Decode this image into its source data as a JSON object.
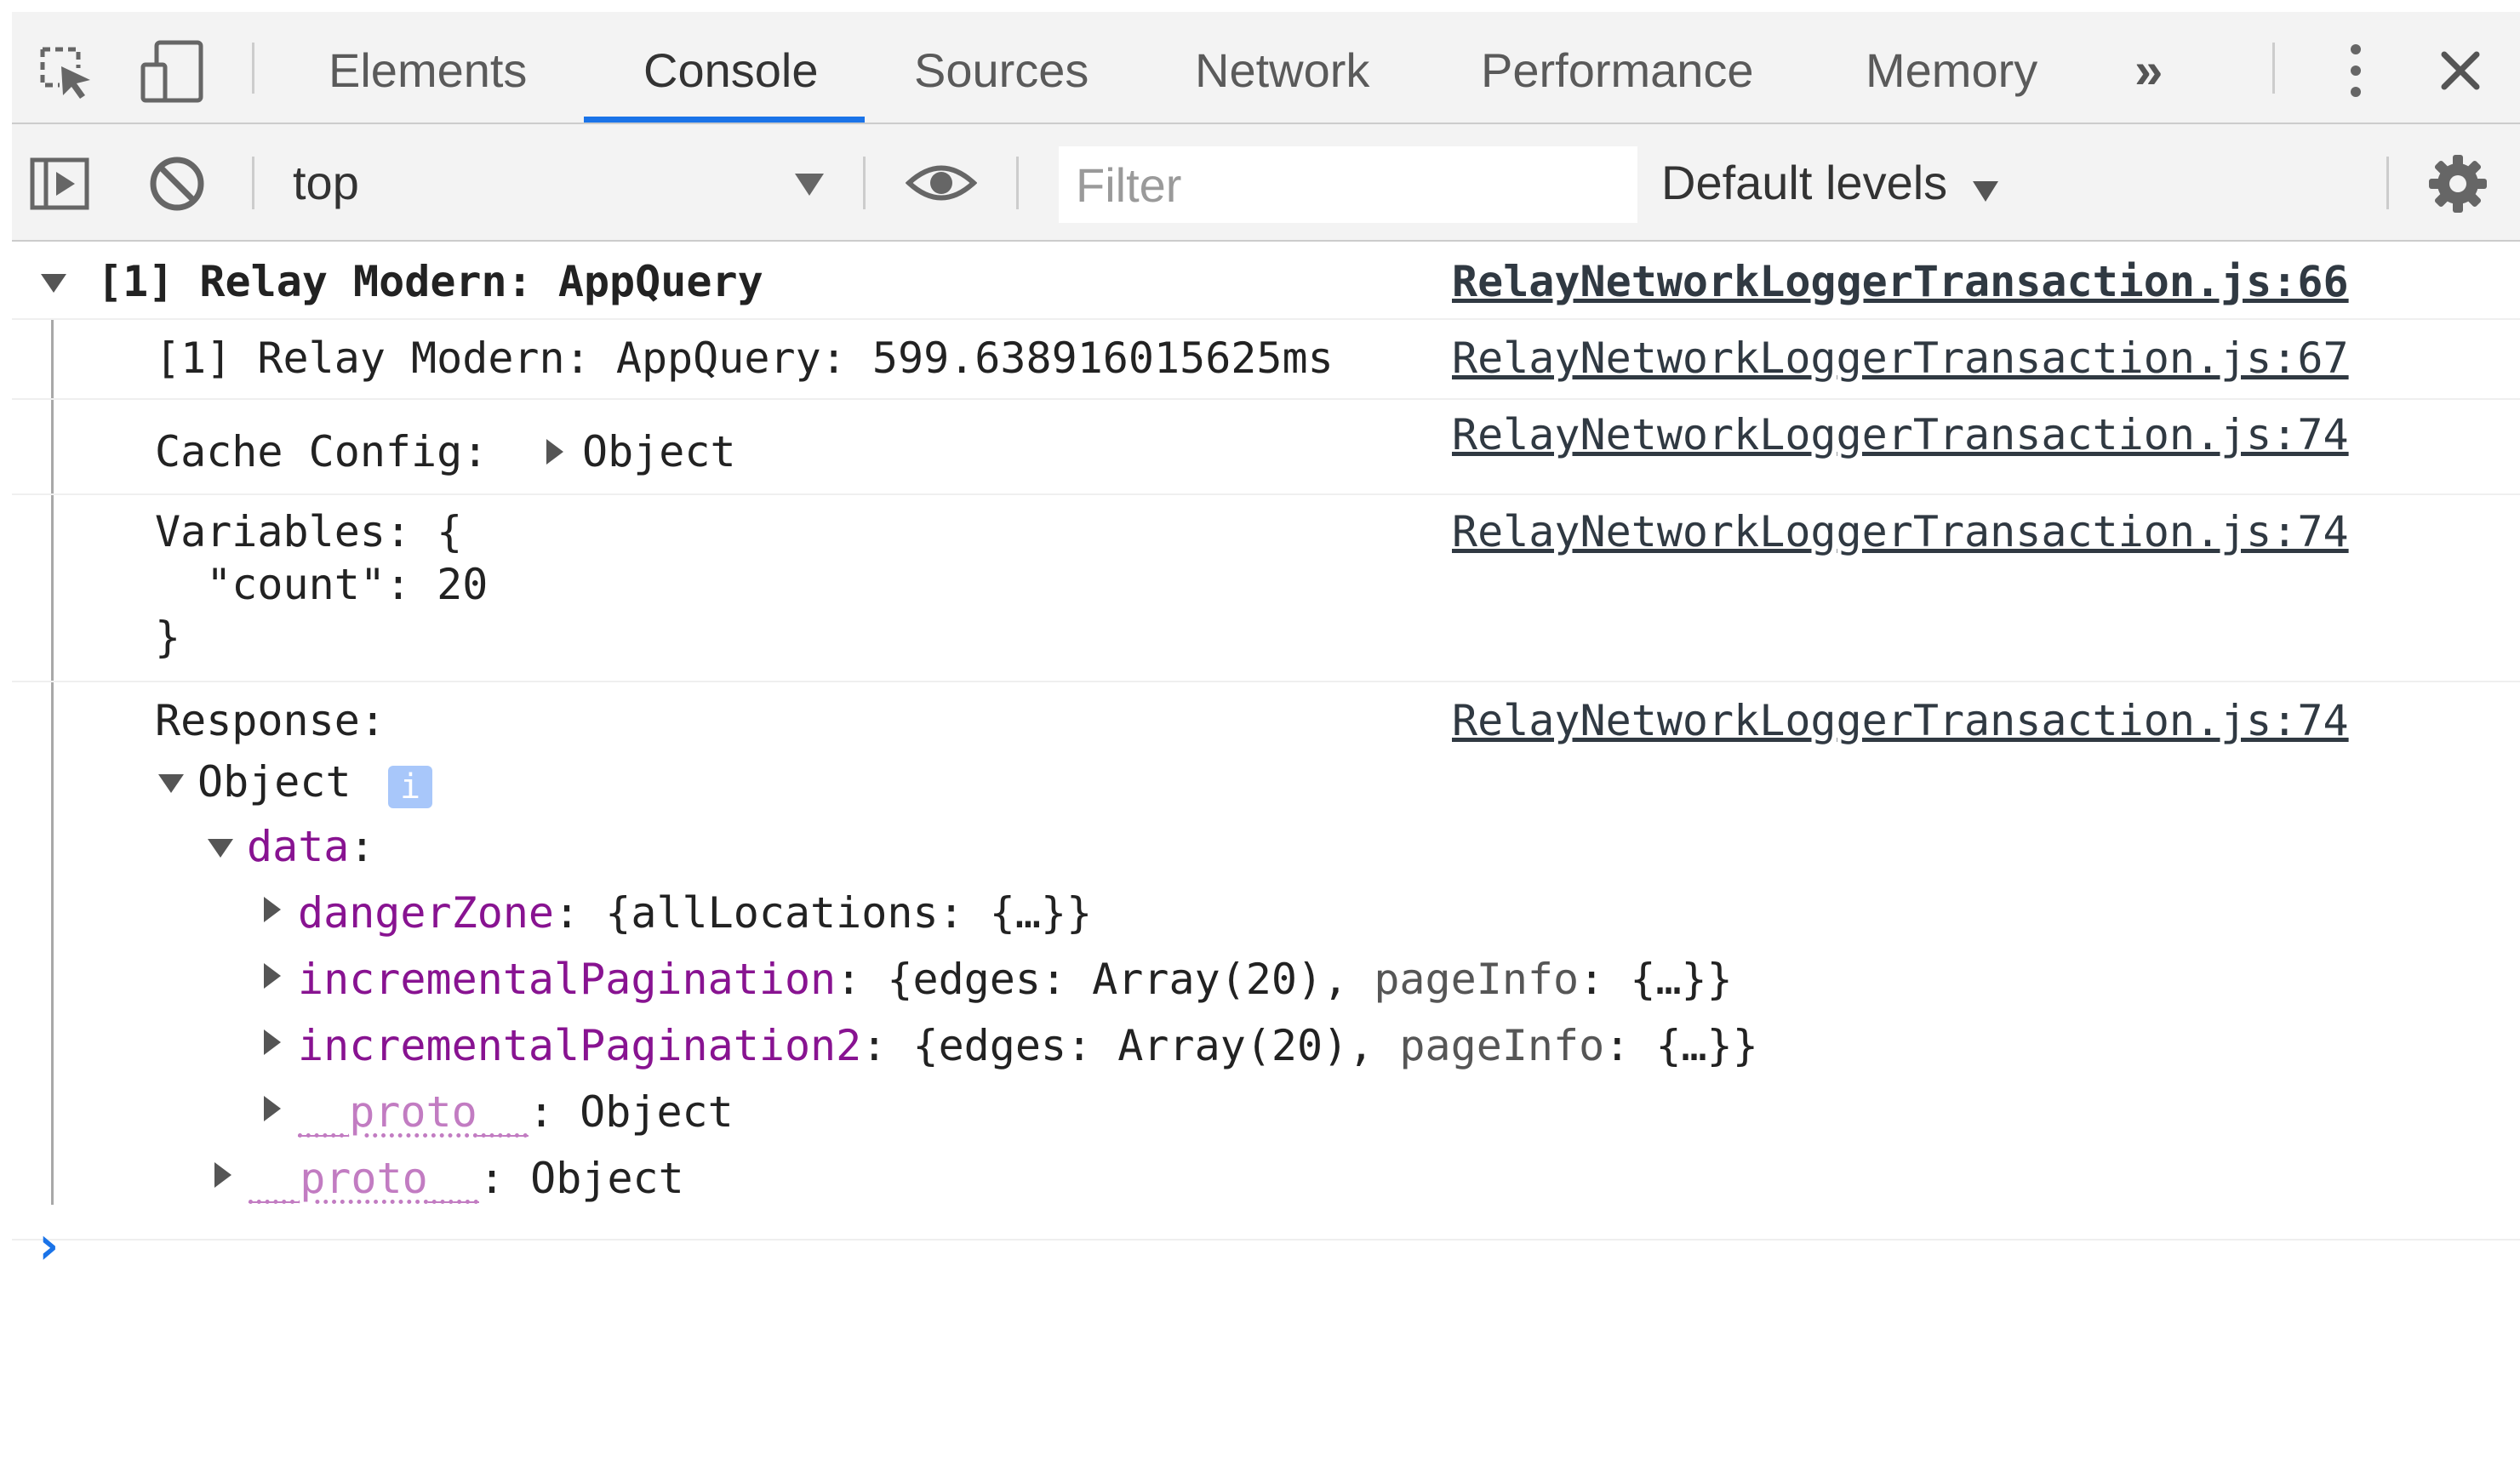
{
  "devtools": {
    "tabs": [
      {
        "label": "Elements"
      },
      {
        "label": "Console"
      },
      {
        "label": "Sources"
      },
      {
        "label": "Network"
      },
      {
        "label": "Performance"
      },
      {
        "label": "Memory"
      }
    ],
    "more_tabs_glyph": "»",
    "active_tab": "Console",
    "accent_color": "#1a73e8",
    "icons": [
      "inspect-element-icon",
      "device-toolbar-icon",
      "more-tabs-icon",
      "kebab-menu-icon",
      "close-icon"
    ]
  },
  "toolbar": {
    "context": "top",
    "filter_placeholder": "Filter",
    "levels": "Default levels",
    "icons": [
      "sidebar-toggle-icon",
      "clear-console-icon",
      "live-expression-eye-icon",
      "settings-gear-icon"
    ]
  },
  "console": {
    "group": {
      "title": "[1] Relay Modern: AppQuery",
      "source": "RelayNetworkLoggerTransaction.js:66"
    },
    "timing": {
      "text": "[1] Relay Modern: AppQuery: 599.638916015625ms",
      "source": "RelayNetworkLoggerTransaction.js:67"
    },
    "cache_config": {
      "label": "Cache Config:",
      "value": "Object",
      "source": "RelayNetworkLoggerTransaction.js:74"
    },
    "variables": {
      "line1": "Variables: {",
      "line2": "  \"count\": 20",
      "line3": "}",
      "source": "RelayNetworkLoggerTransaction.js:74"
    },
    "response": {
      "label": "Response:",
      "source": "RelayNetworkLoggerTransaction.js:74",
      "object_label": "Object",
      "info_badge": "i",
      "data_key": "data",
      "data_colon": ":",
      "entries": [
        {
          "key": "dangerZone",
          "preview": ": {allLocations: {…}}"
        },
        {
          "key": "incrementalPagination",
          "preview_a": ": {edges: Array(20), ",
          "preview_b": "pageInfo",
          "preview_c": ": {…}}"
        },
        {
          "key": "incrementalPagination2",
          "preview_a": ": {edges: Array(20), ",
          "preview_b": "pageInfo",
          "preview_c": ": {…}}"
        },
        {
          "key": "__proto__",
          "preview": ": Object"
        }
      ],
      "outer_proto_key": "__proto__",
      "outer_proto_value": ": Object"
    },
    "prompt_glyph": "›",
    "prompt_color": "#1a73e8"
  }
}
